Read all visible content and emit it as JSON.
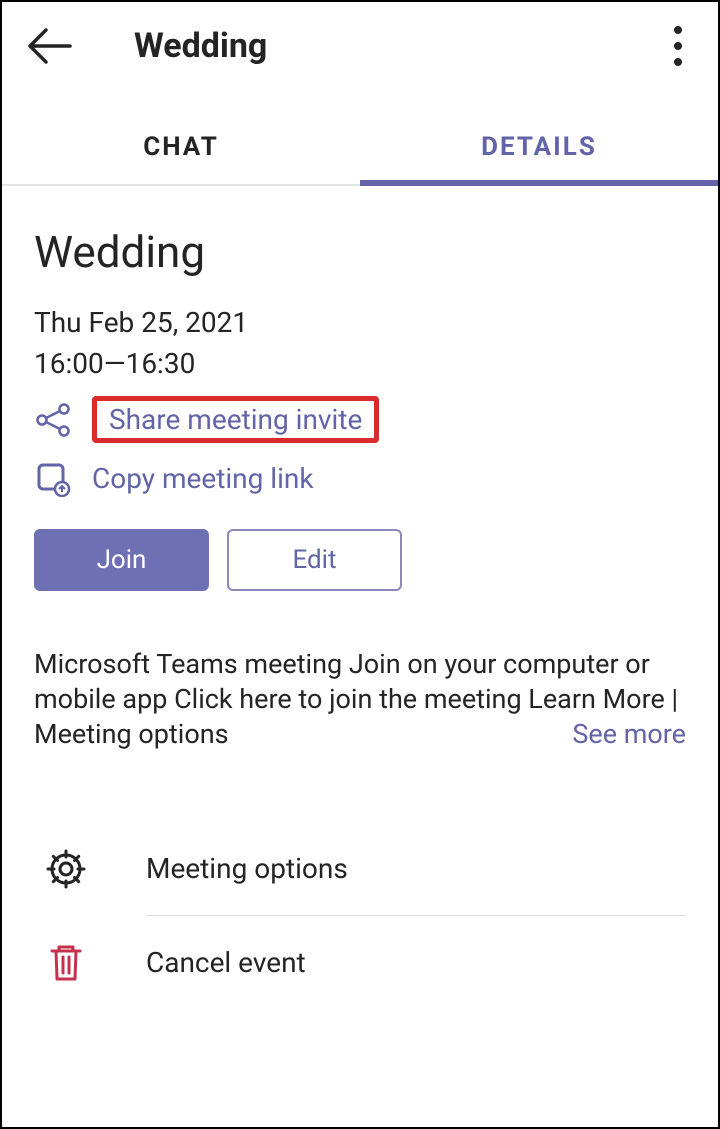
{
  "header": {
    "title": "Wedding"
  },
  "tabs": {
    "chat": "CHAT",
    "details": "DETAILS"
  },
  "event": {
    "title": "Wedding",
    "date": "Thu Feb 25, 2021",
    "time": "16:00—16:30"
  },
  "actions": {
    "share_invite": "Share meeting invite",
    "copy_link": "Copy meeting link"
  },
  "buttons": {
    "join": "Join",
    "edit": "Edit"
  },
  "description": {
    "text": "Microsoft Teams meeting Join on your computer or mobile app Click here to join the meeting Learn More | Meeting options",
    "see_more": "See more"
  },
  "options": {
    "meeting_options": "Meeting options",
    "cancel_event": "Cancel event"
  },
  "colors": {
    "accent": "#6264a7",
    "danger": "#c4314b",
    "highlight": "#d92b2b"
  }
}
